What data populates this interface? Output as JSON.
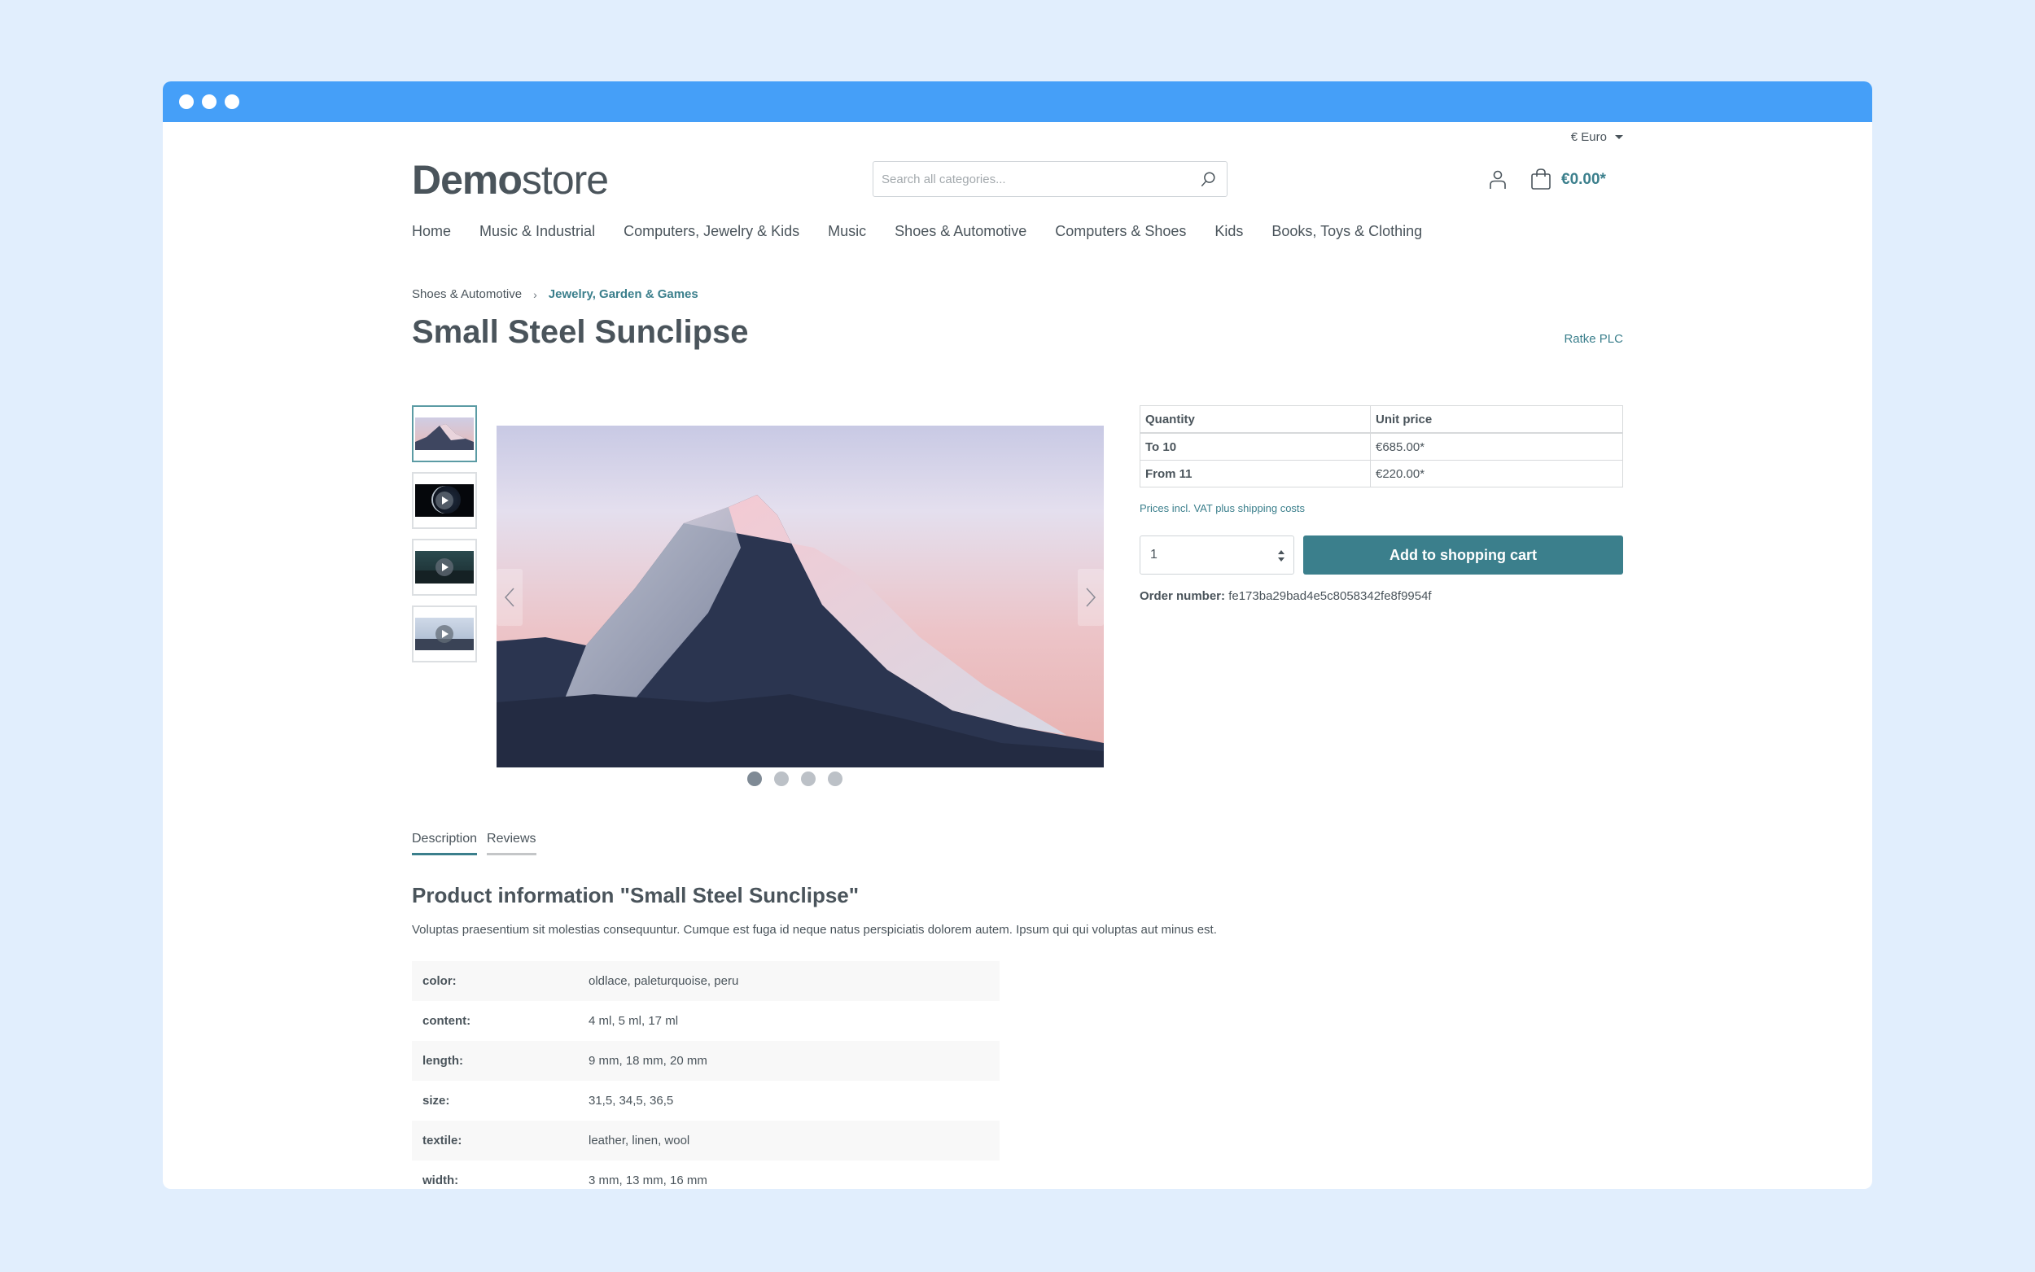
{
  "window": {
    "titlebar_color": "#459ff8"
  },
  "header": {
    "currency": "€ Euro",
    "logo": {
      "bold": "Demo",
      "regular": "store"
    },
    "search_placeholder": "Search all categories...",
    "cart_total": "€0.00*"
  },
  "nav": {
    "items": [
      "Home",
      "Music & Industrial",
      "Computers, Jewelry & Kids",
      "Music",
      "Shoes & Automotive",
      "Computers & Shoes",
      "Kids",
      "Books, Toys & Clothing"
    ]
  },
  "breadcrumb": {
    "items": [
      "Shoes & Automotive",
      "Jewelry, Garden & Games"
    ],
    "separator": "›"
  },
  "product": {
    "title": "Small Steel Sunclipse",
    "manufacturer": "Ratke PLC",
    "gallery": {
      "thumbnails": [
        {
          "type": "image",
          "label": "mountain-peak-sunset",
          "active": true
        },
        {
          "type": "video",
          "label": "moon-eclipse"
        },
        {
          "type": "video",
          "label": "mountain-range-teal"
        },
        {
          "type": "video",
          "label": "snowy-mountains"
        }
      ],
      "slide_count": 4,
      "active_slide": 1
    },
    "price_table": {
      "headers": [
        "Quantity",
        "Unit price"
      ],
      "rows": [
        {
          "quantity": "To 10",
          "price": "€685.00*"
        },
        {
          "quantity": "From 11",
          "price": "€220.00*"
        }
      ]
    },
    "vat_note": "Prices incl. VAT plus shipping costs",
    "quantity_value": "1",
    "add_to_cart_label": "Add to shopping cart",
    "order_number_label": "Order number:",
    "order_number": "fe173ba29bad4e5c8058342fe8f9954f"
  },
  "tabs": [
    {
      "label": "Description",
      "active": true
    },
    {
      "label": "Reviews",
      "active": false
    }
  ],
  "description": {
    "title": "Product information \"Small Steel Sunclipse\"",
    "text": "Voluptas praesentium sit molestias consequuntur. Cumque est fuga id neque natus perspiciatis dolorem autem. Ipsum qui qui voluptas aut minus est.",
    "properties": [
      {
        "key": "color:",
        "value": "oldlace, paleturquoise, peru"
      },
      {
        "key": "content:",
        "value": "4 ml, 5 ml, 17 ml"
      },
      {
        "key": "length:",
        "value": "9 mm, 18 mm, 20 mm"
      },
      {
        "key": "size:",
        "value": "31,5, 34,5, 36,5"
      },
      {
        "key": "textile:",
        "value": "leather, linen, wool"
      },
      {
        "key": "width:",
        "value": "3 mm, 13 mm, 16 mm"
      }
    ]
  },
  "colors": {
    "accent": "#3b7f8c",
    "text": "#4a545b",
    "page_background": "#e1eefd"
  }
}
